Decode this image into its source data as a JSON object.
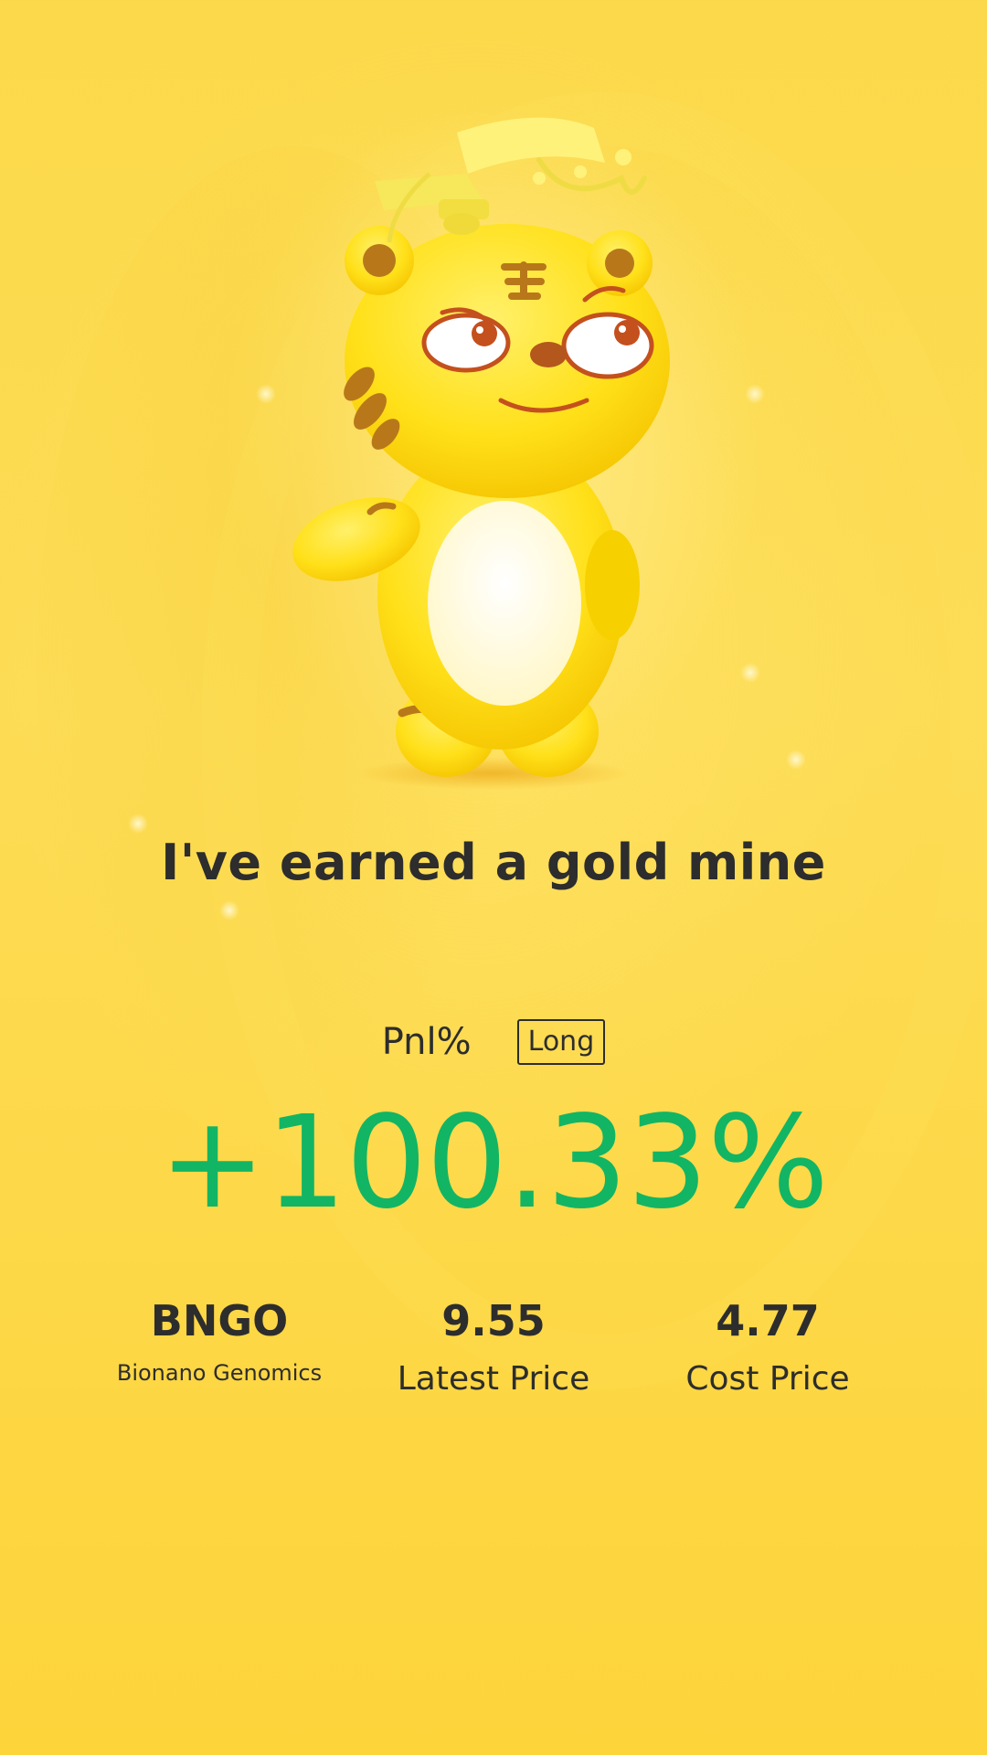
{
  "share_card": {
    "headline": "I've earned a gold mine",
    "pnl_label": "Pnl%",
    "position_side": "Long",
    "pnl_value": "+100.33%",
    "pnl_color": "#12b564"
  },
  "stock": {
    "symbol": "BNGO",
    "name": "Bionano Genomics",
    "latest_price": "9.55",
    "latest_price_label": "Latest Price",
    "cost_price": "4.77",
    "cost_price_label": "Cost Price"
  },
  "mascot": {
    "icon": "tiger-mascot-with-graduation-cap",
    "colors": {
      "body": "#ffe019",
      "belly": "#ffffff",
      "stripes": "#b8781a"
    }
  }
}
